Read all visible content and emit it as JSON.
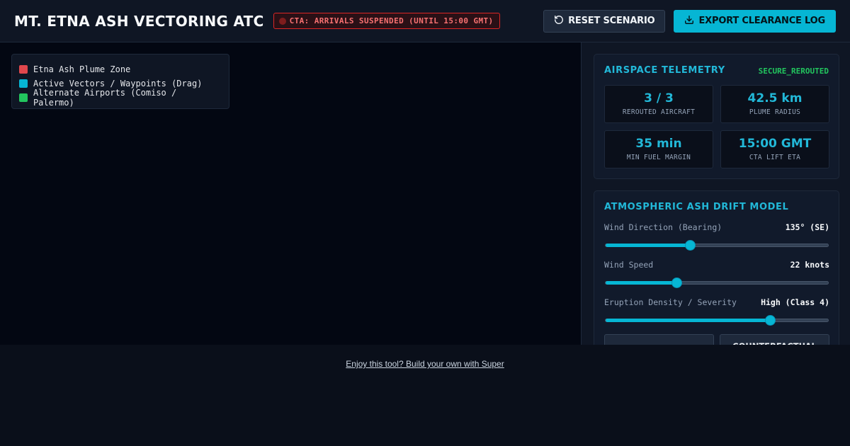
{
  "header": {
    "title": "MT. ETNA ASH VECTORING ATC",
    "cta_badge": "CTA: ARRIVALS SUSPENDED (UNTIL 15:00 GMT)",
    "reset_label": "RESET SCENARIO",
    "reset_icon": "rotate-ccw-icon",
    "export_label": "EXPORT CLEARANCE LOG",
    "export_icon": "download-icon"
  },
  "legend": {
    "items": [
      {
        "label": "Etna Ash Plume Zone",
        "color": "#e0474c"
      },
      {
        "label": "Active Vectors / Waypoints (Drag)",
        "color": "#06b6d4"
      },
      {
        "label": "Alternate Airports (Comiso / Palermo)",
        "color": "#22c55e"
      }
    ]
  },
  "telemetry": {
    "title": "AIRSPACE TELEMETRY",
    "status": "SECURE_REROUTED",
    "cards": [
      {
        "value": "3 / 3",
        "label": "REROUTED AIRCRAFT"
      },
      {
        "value": "42.5 km",
        "label": "PLUME RADIUS"
      },
      {
        "value": "35 min",
        "label": "MIN FUEL MARGIN"
      },
      {
        "value": "15:00 GMT",
        "label": "CTA LIFT ETA"
      }
    ]
  },
  "drift_model": {
    "title": "ATMOSPHERIC ASH DRIFT MODEL",
    "sliders": [
      {
        "label": "Wind Direction (Bearing)",
        "value": "135° (SE)",
        "fraction": 0.38
      },
      {
        "label": "Wind Speed",
        "value": "22 knots",
        "fraction": 0.32
      },
      {
        "label": "Eruption Density / Severity",
        "value": "High (Class 4)",
        "fraction": 0.74
      }
    ],
    "buttons": [
      "",
      "COUNTERFACTUAL"
    ]
  },
  "colors": {
    "accent": "#06b6d4",
    "danger": "#dc2626",
    "success": "#22c55e",
    "background": "#0a0f1a"
  },
  "footer": {
    "link_text": "Enjoy this tool? Build your own with Super"
  }
}
